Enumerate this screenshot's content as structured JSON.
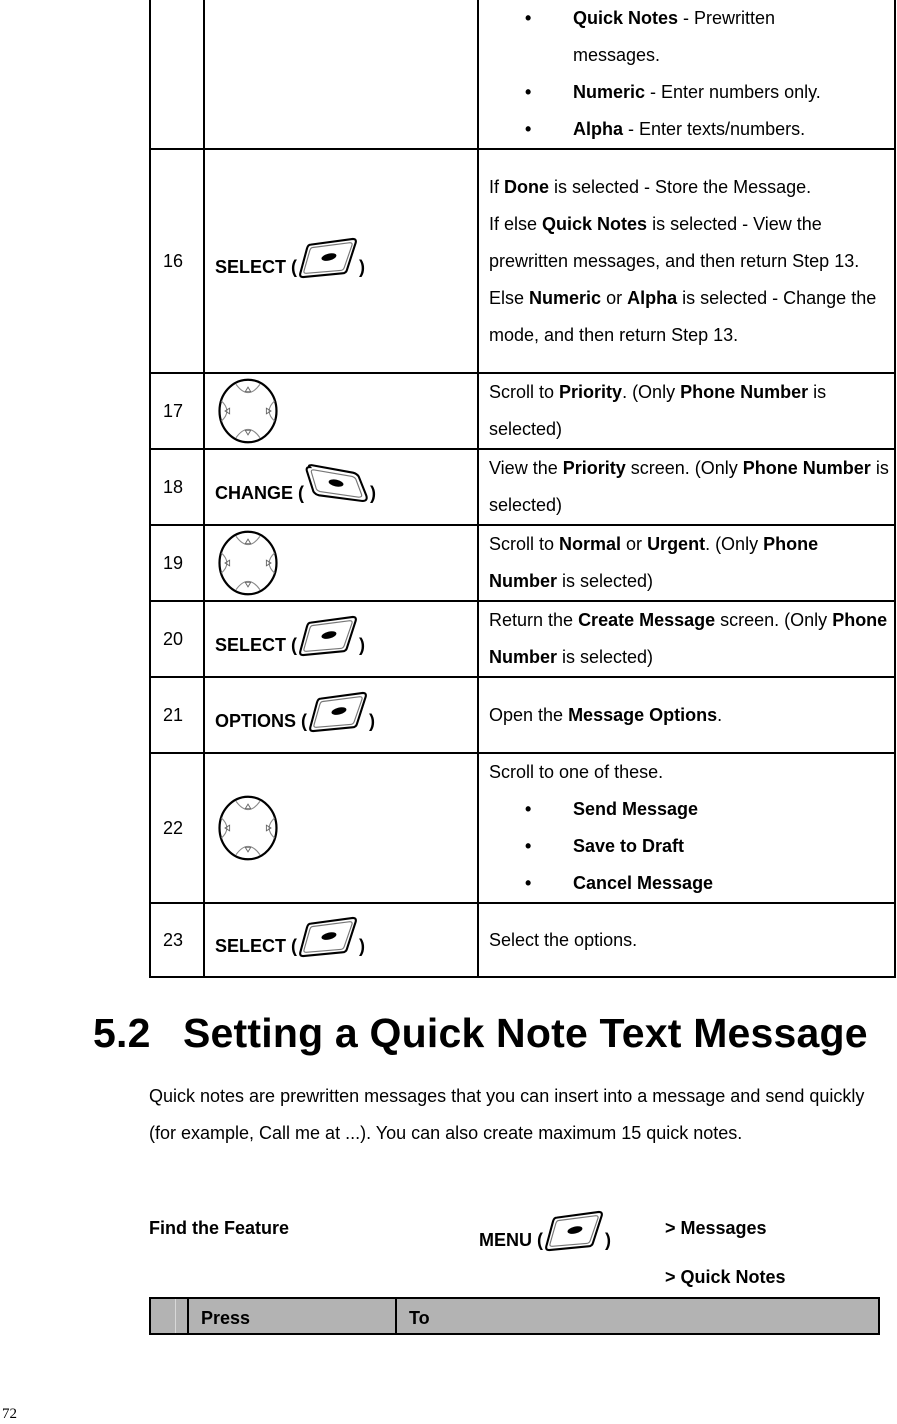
{
  "steps_table": {
    "continued_row": {
      "bullets": [
        {
          "bold": "Quick Notes",
          "text": " - Prewritten",
          "continuation": "messages."
        },
        {
          "bold": "Numeric",
          "text": " - Enter numbers only."
        },
        {
          "bold": "Alpha",
          "text": " - Enter texts/numbers."
        }
      ]
    },
    "rows": [
      {
        "num": "16",
        "key_label": "SELECT (",
        "key_close": ")",
        "key_icon": "softkey-icon",
        "lines": [
          {
            "p1": "If ",
            "b1": "Done",
            "p2": " is selected - Store the Message."
          },
          {
            "p1": "If else ",
            "b1": "Quick Notes",
            "p2": " is selected - View the prewritten messages, and then return Step 13."
          },
          {
            "p1": "Else ",
            "b1": "Numeric",
            "p2": " or ",
            "b2": "Alpha",
            "p3": " is selected - Change the mode, and then return Step 13."
          }
        ]
      },
      {
        "num": "17",
        "key_icon": "navigation-key-icon",
        "p1": "Scroll to ",
        "b1": "Priority",
        "p2": ". (Only ",
        "b2": "Phone Number",
        "p3": " is selected)"
      },
      {
        "num": "18",
        "key_label": "CHANGE (",
        "key_close": ")",
        "key_icon": "softkey-right-icon",
        "p1": "View the ",
        "b1": "Priority",
        "p2": " screen. (Only ",
        "b2": "Phone Number",
        "p3": " is selected)"
      },
      {
        "num": "19",
        "key_icon": "navigation-key-icon",
        "p1": "Scroll to ",
        "b1": "Normal",
        "p2": " or ",
        "b2": "Urgent",
        "p3": ". (Only ",
        "b3": "Phone Number",
        "p4": " is selected)"
      },
      {
        "num": "20",
        "key_label": "SELECT (",
        "key_close": ")",
        "key_icon": "softkey-icon",
        "p1": "Return the ",
        "b1": "Create Message",
        "p2": " screen. (Only ",
        "b2": "Phone Number",
        "p3": " is selected)"
      },
      {
        "num": "21",
        "key_label": "OPTIONS (",
        "key_close": ")",
        "key_icon": "softkey-icon",
        "p1": "Open the ",
        "b1": "Message Options",
        "p2": "."
      },
      {
        "num": "22",
        "key_icon": "navigation-key-icon",
        "intro": "Scroll to one of these.",
        "bullets": [
          "Send Message",
          "Save to Draft",
          "Cancel Message"
        ]
      },
      {
        "num": "23",
        "key_label": "SELECT (",
        "key_close": ")",
        "key_icon": "softkey-icon",
        "text": "Select the options."
      }
    ]
  },
  "section": {
    "number": "5.2",
    "title": "Setting a Quick Note Text Message",
    "intro": "Quick notes are prewritten messages that you can insert into a message and send quickly (for example, Call me at ...). You can also create maximum 15 quick notes."
  },
  "find_feature": {
    "label": "Find the Feature",
    "menu_label": "MENU (",
    "menu_close": ")",
    "path": [
      "> Messages",
      "> Quick Notes"
    ]
  },
  "next_table_header": {
    "columns": [
      "",
      "Press",
      "To"
    ]
  },
  "page_number": "72"
}
